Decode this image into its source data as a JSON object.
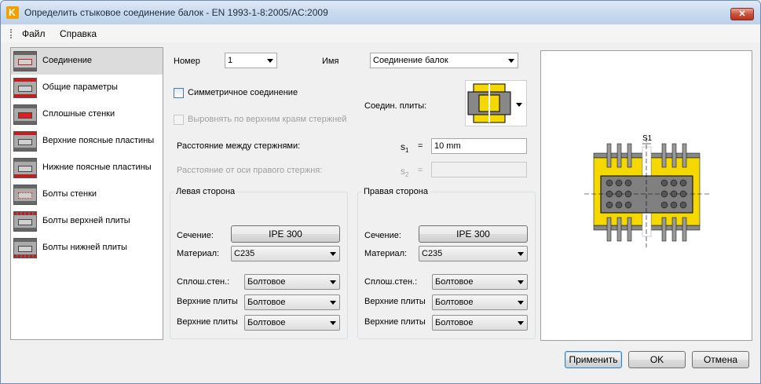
{
  "window": {
    "title": "Определить стыковое соединение балок - EN 1993-1-8:2005/AC:2009",
    "close_label": "✕"
  },
  "menu": {
    "items": [
      {
        "label": "Файл"
      },
      {
        "label": "Справка"
      }
    ]
  },
  "sidebar": {
    "items": [
      {
        "label": "Соединение"
      },
      {
        "label": "Общие параметры"
      },
      {
        "label": "Сплошные стенки"
      },
      {
        "label": "Верхние поясные пластины"
      },
      {
        "label": "Нижние поясные пластины"
      },
      {
        "label": "Болты стенки"
      },
      {
        "label": "Болты верхней плиты"
      },
      {
        "label": "Болты нижней плиты"
      }
    ]
  },
  "form": {
    "number_label": "Номер",
    "number_value": "1",
    "name_label": "Имя",
    "name_value": "Соединение балок",
    "symmetric_label": "Симметричное соединение",
    "align_label": "Выровнять по верхним краям стержней",
    "plates_label": "Соедин. плиты:",
    "distance_label": "Расстояние между стержнями:",
    "s1_symbol": "s",
    "s1_sub": "1",
    "eq": "=",
    "s1_value": "10 mm",
    "offset_label": "Расстояние от оси правого стержня:",
    "s2_symbol": "s",
    "s2_sub": "2",
    "s2_value": ""
  },
  "left": {
    "title": "Левая сторона",
    "section_label": "Сечение:",
    "section_value": "IPE 300",
    "material_label": "Материал:",
    "material_value": "C235",
    "web_label": "Сплош.стен.:",
    "web_value": "Болтовое",
    "top_label": "Верхние плиты",
    "top_value": "Болтовое",
    "bottom_label": "Верхние плиты",
    "bottom_value": "Болтовое"
  },
  "right": {
    "title": "Правая сторона",
    "section_label": "Сечение:",
    "section_value": "IPE 300",
    "material_label": "Материал:",
    "material_value": "C235",
    "web_label": "Сплош.стен.:",
    "web_value": "Болтовое",
    "top_label": "Верхние плиты",
    "top_value": "Болтовое",
    "bottom_label": "Верхние плиты",
    "bottom_value": "Болтовое"
  },
  "preview": {
    "dimension_label": "S1"
  },
  "buttons": {
    "apply": "Применить",
    "ok": "OK",
    "cancel": "Отмена"
  },
  "colors": {
    "plate_yellow": "#f5d800",
    "beam_gray": "#808080",
    "accent_red": "#e02020",
    "app_orange": "#f0a000"
  }
}
